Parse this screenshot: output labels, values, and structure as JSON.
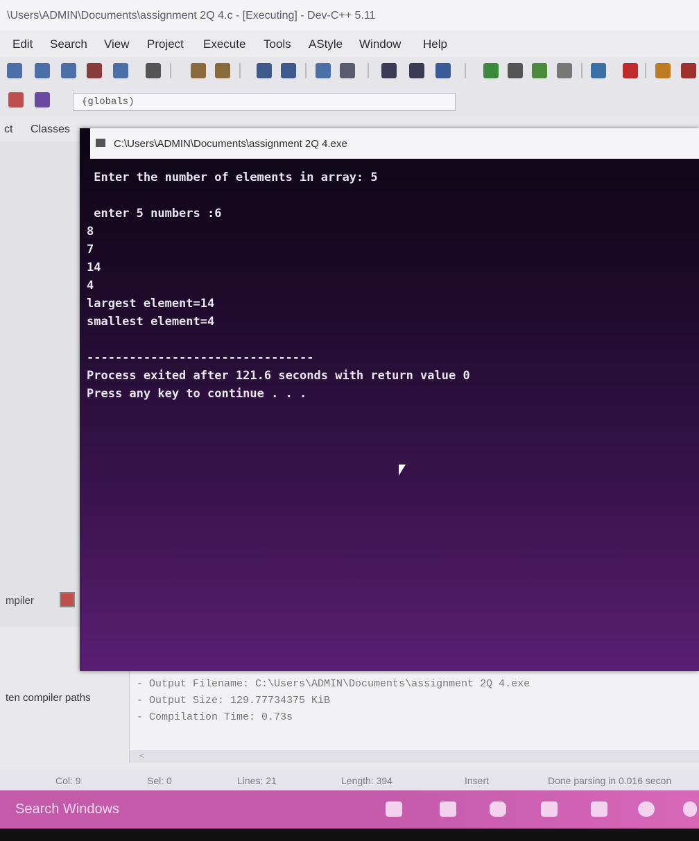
{
  "ide": {
    "title": "\\Users\\ADMIN\\Documents\\assignment 2Q 4.c - [Executing] - Dev-C++ 5.11",
    "menu": [
      "Edit",
      "Search",
      "View",
      "Project",
      "Execute",
      "Tools",
      "AStyle",
      "Window",
      "Help"
    ],
    "scope_select": "(globals)",
    "side_tabs": [
      "ct",
      "Classes"
    ],
    "compiler_tab": "mpiler",
    "compiler_paths_label": "ten compiler paths",
    "log_lines": [
      "- Output Filename: C:\\Users\\ADMIN\\Documents\\assignment 2Q 4.exe",
      "- Output Size: 129.77734375 KiB",
      "- Compilation Time: 0.73s"
    ],
    "log_scroll_arrow": "<"
  },
  "statusbar": {
    "col": "Col:   9",
    "sel": "Sel:   0",
    "lines": "Lines:   21",
    "length": "Length:  394",
    "mode": "Insert",
    "parse": "Done parsing in 0.016 secon"
  },
  "console": {
    "title": "C:\\Users\\ADMIN\\Documents\\assignment 2Q 4.exe",
    "lines": [
      " Enter the number of elements in array: 5",
      "",
      " enter 5 numbers :6",
      "8",
      "7",
      "14",
      "4",
      "largest element=14",
      "smallest element=4",
      "",
      "--------------------------------",
      "Process exited after 121.6 seconds with return value 0",
      "Press any key to continue . . ."
    ]
  },
  "taskbar": {
    "search_placeholder": "Search Windows"
  }
}
